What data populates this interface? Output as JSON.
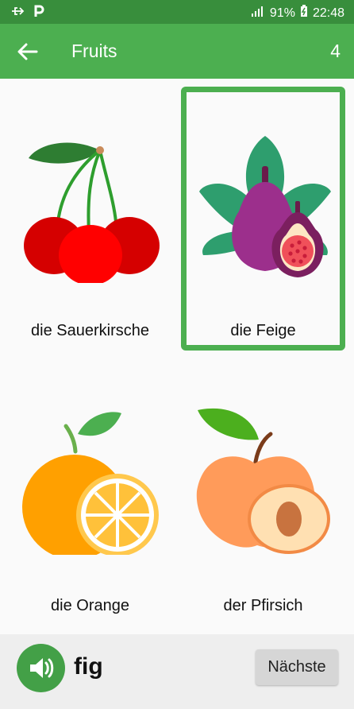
{
  "status_bar": {
    "usb_icon": "usb-icon",
    "notification_icon": "p-icon",
    "battery": "91%",
    "time": "22:48"
  },
  "app_bar": {
    "back_icon": "arrow-left-icon",
    "title": "Fruits",
    "count": "4"
  },
  "cards": [
    {
      "label": "die Sauerkirsche",
      "icon": "cherry-icon",
      "selected": false
    },
    {
      "label": "die Feige",
      "icon": "fig-icon",
      "selected": true
    },
    {
      "label": "die Orange",
      "icon": "orange-icon",
      "selected": false
    },
    {
      "label": "der Pfirsich",
      "icon": "peach-icon",
      "selected": false
    }
  ],
  "bottom_bar": {
    "speaker_icon": "speaker-icon",
    "word": "fig",
    "next_label": "Nächste"
  },
  "colors": {
    "status_bar": "#388e3c",
    "app_bar": "#4caf50",
    "selection_border": "#4caf50",
    "speaker_button": "#43a047"
  }
}
